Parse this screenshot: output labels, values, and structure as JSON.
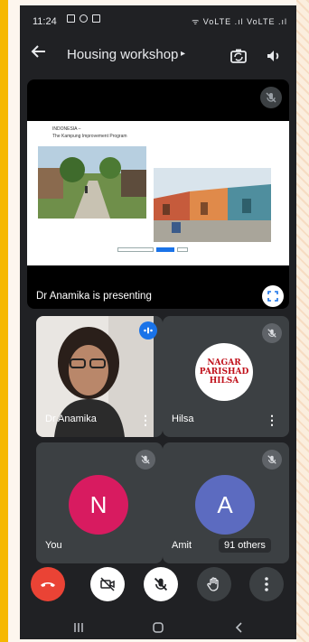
{
  "status_bar": {
    "time": "11:24",
    "right_text": "ᯤ VoLTE .ıl VoLTE .ıl"
  },
  "header": {
    "title": "Housing workshop",
    "title_caret": "▸"
  },
  "presentation": {
    "slide_heading": "INDONESIA –",
    "slide_subheading": "The Kampung Improvement Program",
    "presenting_label": "Dr Anamika is presenting"
  },
  "participants": [
    {
      "name": "Dr Anamika"
    },
    {
      "name": "Hilsa",
      "logo_lines": [
        "NAGAR",
        "PARISHAD",
        "HILSA"
      ]
    },
    {
      "name": "You",
      "initial": "N",
      "avatar_color": "#d81b60"
    },
    {
      "name": "Amit",
      "initial": "A",
      "avatar_color": "#5c6bc0"
    }
  ],
  "others_label": "91 others",
  "colors": {
    "end_call": "#ea4335",
    "active_speaker": "#1a73e8",
    "tile_bg": "#3c4043",
    "screen_bg": "#202124"
  },
  "icons": {
    "back": "arrow-left-icon",
    "switch_camera": "switch-camera-icon",
    "speaker": "speaker-icon",
    "mic_off": "mic-off-icon",
    "fullscreen": "fullscreen-icon",
    "end_call": "phone-hangup-icon",
    "camera_off": "camera-off-icon",
    "raise_hand": "hand-icon",
    "more": "more-vert-icon"
  }
}
